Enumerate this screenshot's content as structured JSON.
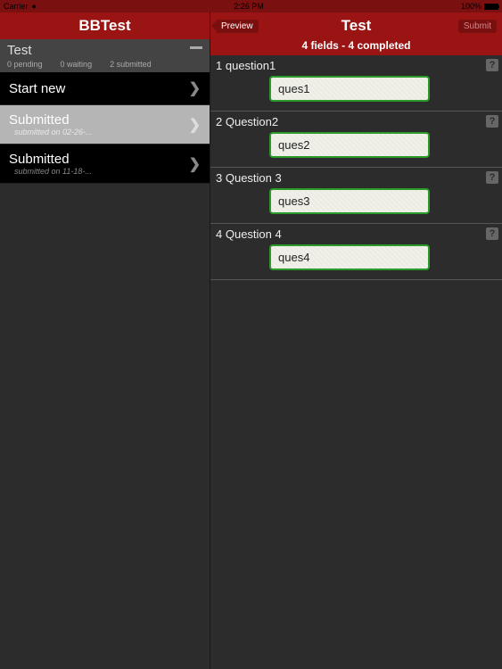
{
  "status": {
    "carrier": "Carrier",
    "time": "2:26 PM",
    "battery": "100%"
  },
  "left": {
    "header": "BBTest",
    "summary": {
      "title": "Test",
      "pending": "0 pending",
      "waiting": "0 waiting",
      "submitted": "2 submitted"
    },
    "items": [
      {
        "title": "Start new",
        "sub": ""
      },
      {
        "title": "Submitted",
        "sub": "submitted on 02-26-..."
      },
      {
        "title": "Submitted",
        "sub": "submitted on 11-18-..."
      }
    ]
  },
  "right": {
    "preview": "Preview",
    "submit": "Submit",
    "title": "Test",
    "subtitle": "4 fields - 4 completed",
    "questions": [
      {
        "num": "1",
        "label": "question1",
        "value": "ques1"
      },
      {
        "num": "2",
        "label": "Question2",
        "value": "ques2"
      },
      {
        "num": "3",
        "label": "Question 3",
        "value": "ques3"
      },
      {
        "num": "4",
        "label": "Question 4",
        "value": "ques4"
      }
    ]
  }
}
